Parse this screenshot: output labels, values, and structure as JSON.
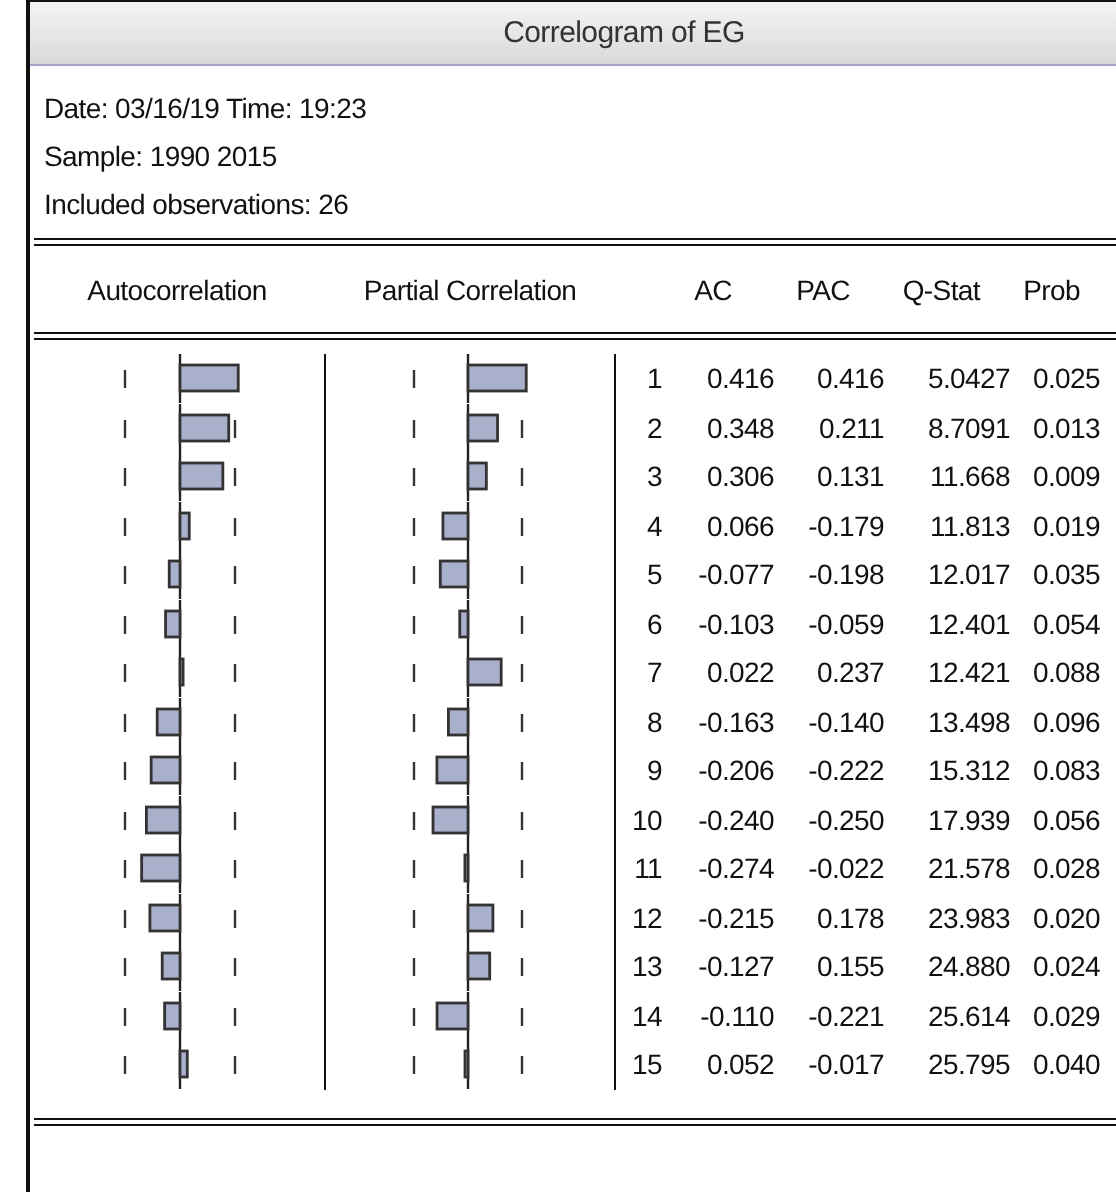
{
  "window": {
    "title": "Correlogram of EG"
  },
  "info": [
    "Date: 03/16/19   Time: 19:23",
    "Sample: 1990 2015",
    "Included observations: 26"
  ],
  "columns": [
    "Autocorrelation",
    "Partial Correlation",
    "AC",
    "PAC",
    "Q-Stat",
    "Prob"
  ],
  "rows": [
    {
      "lag": "1",
      "ac": "0.416",
      "pac": "0.416",
      "q_stat": "5.0427",
      "prob": "0.025"
    },
    {
      "lag": "2",
      "ac": "0.348",
      "pac": "0.211",
      "q_stat": "8.7091",
      "prob": "0.013"
    },
    {
      "lag": "3",
      "ac": "0.306",
      "pac": "0.131",
      "q_stat": "11.668",
      "prob": "0.009"
    },
    {
      "lag": "4",
      "ac": "0.066",
      "pac": "-0.179",
      "q_stat": "11.813",
      "prob": "0.019"
    },
    {
      "lag": "5",
      "ac": "-0.077",
      "pac": "-0.198",
      "q_stat": "12.017",
      "prob": "0.035"
    },
    {
      "lag": "6",
      "ac": "-0.103",
      "pac": "-0.059",
      "q_stat": "12.401",
      "prob": "0.054"
    },
    {
      "lag": "7",
      "ac": "0.022",
      "pac": "0.237",
      "q_stat": "12.421",
      "prob": "0.088"
    },
    {
      "lag": "8",
      "ac": "-0.163",
      "pac": "-0.140",
      "q_stat": "13.498",
      "prob": "0.096"
    },
    {
      "lag": "9",
      "ac": "-0.206",
      "pac": "-0.222",
      "q_stat": "15.312",
      "prob": "0.083"
    },
    {
      "lag": "10",
      "ac": "-0.240",
      "pac": "-0.250",
      "q_stat": "17.939",
      "prob": "0.056"
    },
    {
      "lag": "11",
      "ac": "-0.274",
      "pac": "-0.022",
      "q_stat": "21.578",
      "prob": "0.028"
    },
    {
      "lag": "12",
      "ac": "-0.215",
      "pac": "0.178",
      "q_stat": "23.983",
      "prob": "0.020"
    },
    {
      "lag": "13",
      "ac": "-0.127",
      "pac": "0.155",
      "q_stat": "24.880",
      "prob": "0.024"
    },
    {
      "lag": "14",
      "ac": "-0.110",
      "pac": "-0.221",
      "q_stat": "25.614",
      "prob": "0.029"
    },
    {
      "lag": "15",
      "ac": "0.052",
      "pac": "-0.017",
      "q_stat": "25.795",
      "prob": "0.040"
    }
  ]
}
